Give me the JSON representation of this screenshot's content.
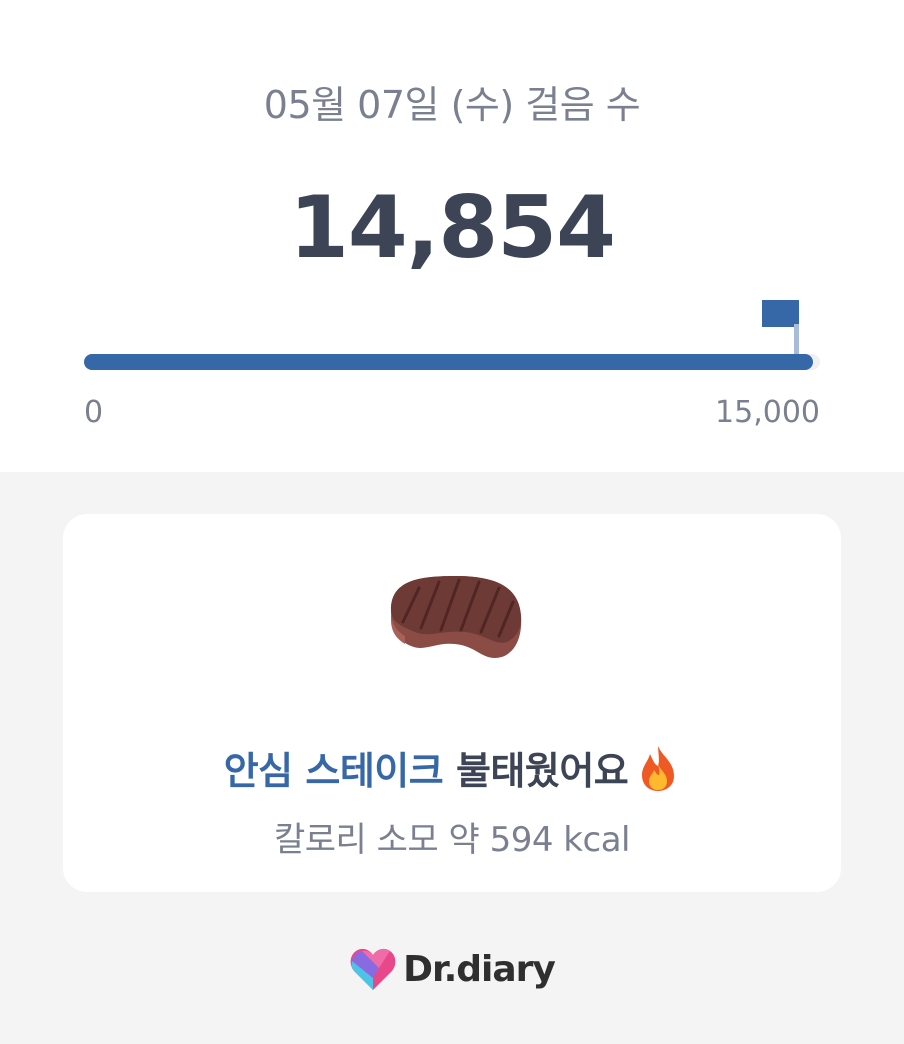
{
  "header": {
    "date_title": "05월 07일 (수) 걸음 수",
    "step_count": "14,854"
  },
  "progress": {
    "steps": 14854,
    "goal": 15000,
    "fraction": 0.99,
    "min_label": "0",
    "max_label": "15,000",
    "fill_color": "#3668a8",
    "goal_icon": "flag-icon"
  },
  "card": {
    "food_icon": "steak-icon",
    "food_name": "안심 스테이크",
    "burned_text": "불태웠어요",
    "burn_icon": "fire-icon",
    "calorie_text": "칼로리 소모 약 594 kcal"
  },
  "brand": {
    "logo_icon": "heart-logo-icon",
    "name": "Dr.diary"
  },
  "colors": {
    "accent": "#3668a8",
    "text_dark": "#3c4455",
    "text_muted": "#7a8090",
    "background": "#f4f4f4"
  }
}
